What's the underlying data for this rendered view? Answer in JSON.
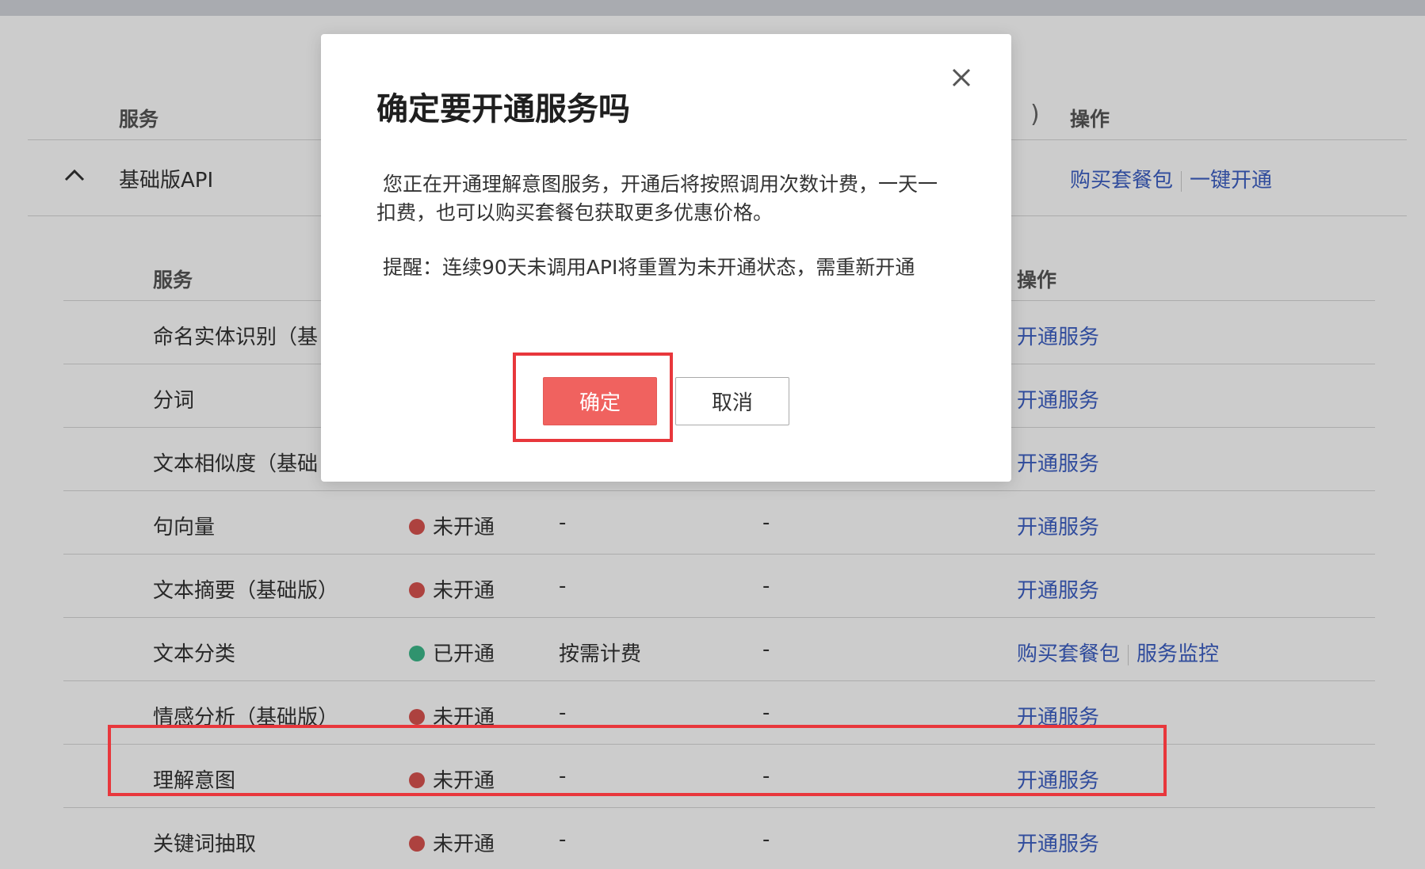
{
  "outer_table": {
    "header_service": "服务",
    "header_paren": ")",
    "header_ops": "操作",
    "group": {
      "name": "基础版API",
      "op_buy": "购买套餐包",
      "op_enable_all": "一键开通"
    }
  },
  "inner_table": {
    "header_service": "服务",
    "header_ops": "操作",
    "rows": [
      {
        "name": "命名实体识别（基",
        "status": "",
        "billing": "",
        "extra": "",
        "ops": [
          "开通服务"
        ]
      },
      {
        "name": "分词",
        "status": "",
        "billing": "",
        "extra": "",
        "ops": [
          "开通服务"
        ]
      },
      {
        "name": "文本相似度（基础",
        "status": "",
        "billing": "",
        "extra": "",
        "ops": [
          "开通服务"
        ]
      },
      {
        "name": "句向量",
        "status": "未开通",
        "billing": "-",
        "extra": "-",
        "ops": [
          "开通服务"
        ]
      },
      {
        "name": "文本摘要（基础版）",
        "status": "未开通",
        "billing": "-",
        "extra": "-",
        "ops": [
          "开通服务"
        ]
      },
      {
        "name": "文本分类",
        "status": "已开通",
        "billing": "按需计费",
        "extra": "-",
        "ops": [
          "购买套餐包",
          "服务监控"
        ]
      },
      {
        "name": "情感分析（基础版）",
        "status": "未开通",
        "billing": "-",
        "extra": "-",
        "ops": [
          "开通服务"
        ]
      },
      {
        "name": "理解意图",
        "status": "未开通",
        "billing": "-",
        "extra": "-",
        "ops": [
          "开通服务"
        ]
      },
      {
        "name": "关键词抽取",
        "status": "未开通",
        "billing": "-",
        "extra": "-",
        "ops": [
          "开通服务"
        ]
      }
    ]
  },
  "modal": {
    "title": "确定要开通服务吗",
    "close_icon": "close-icon",
    "body": "您正在开通理解意图服务，开通后将按照调用次数计费，一天一扣费，也可以购买套餐包获取更多优惠价格。",
    "note": "提醒：连续90天未调用API将重置为未开通状态，需重新开通",
    "confirm_label": "确定",
    "cancel_label": "取消"
  },
  "colors": {
    "status_off": "#d9534f",
    "status_on": "#3cb88a",
    "link": "#3d5fc4",
    "primary_button": "#f0625f",
    "highlight": "#e8373c"
  }
}
